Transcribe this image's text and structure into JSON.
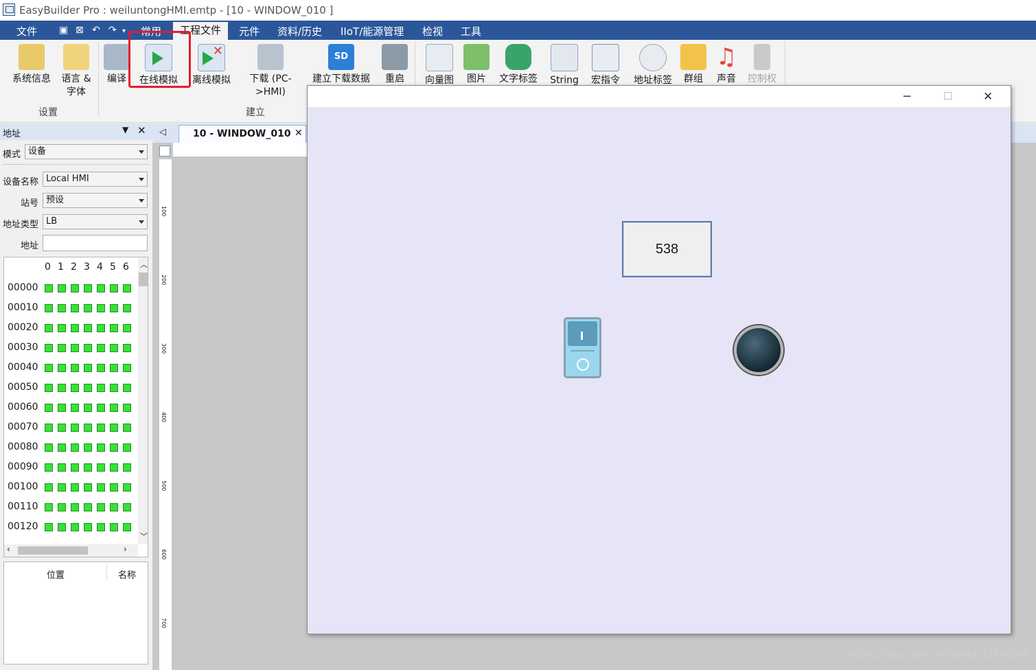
{
  "window": {
    "title": "EasyBuilder Pro : weiluntongHMI.emtp - [10 - WINDOW_010 ]"
  },
  "menubar": {
    "items": [
      "文件",
      "常用",
      "工程文件",
      "元件",
      "资料/历史",
      "IIoT/能源管理",
      "检视",
      "工具"
    ],
    "active": "工程文件"
  },
  "ribbon": {
    "buttons": [
      {
        "label": "系统信息"
      },
      {
        "label": "语言 &",
        "label2": "字体"
      },
      {
        "label": "编译"
      },
      {
        "label": "在线模拟"
      },
      {
        "label": "离线模拟"
      },
      {
        "label": "下载 (PC-",
        "label2": ">HMI)"
      },
      {
        "label": "建立下载数据"
      },
      {
        "label": "重启"
      },
      {
        "label": "向量图"
      },
      {
        "label": "图片"
      },
      {
        "label": "文字标签"
      },
      {
        "label": "String"
      },
      {
        "label": "宏指令"
      },
      {
        "label": "地址标签"
      },
      {
        "label": "群组"
      },
      {
        "label": "声音"
      },
      {
        "label": "控制权"
      }
    ],
    "groups": [
      "设置",
      "建立"
    ]
  },
  "address_panel": {
    "title": "地址",
    "mode_label": "模式",
    "mode_value": "设备",
    "device_label": "设备名称",
    "device_value": "Local HMI",
    "station_label": "站号",
    "station_value": "预设",
    "type_label": "地址类型",
    "type_value": "LB",
    "address_label": "地址",
    "address_value": "",
    "columns": [
      "0",
      "1",
      "2",
      "3",
      "4",
      "5",
      "6"
    ],
    "rows": [
      "00000",
      "00010",
      "00020",
      "00030",
      "00040",
      "00050",
      "00060",
      "00070",
      "00080",
      "00090",
      "00100",
      "00110",
      "00120"
    ],
    "table_headers": [
      "位置",
      "名称"
    ]
  },
  "tab": {
    "label": "10 - WINDOW_010"
  },
  "ruler_labels": [
    "100",
    "200",
    "300",
    "400",
    "500",
    "600",
    "700"
  ],
  "sim": {
    "number_value": "538"
  },
  "watermark": "https://blog.csdn.net/baidu_41706898",
  "colors": {
    "menubar": "#2b579a",
    "highlight": "#e8192c",
    "bit_on": "#37e237",
    "sim_bg": "#e5e5f7"
  }
}
